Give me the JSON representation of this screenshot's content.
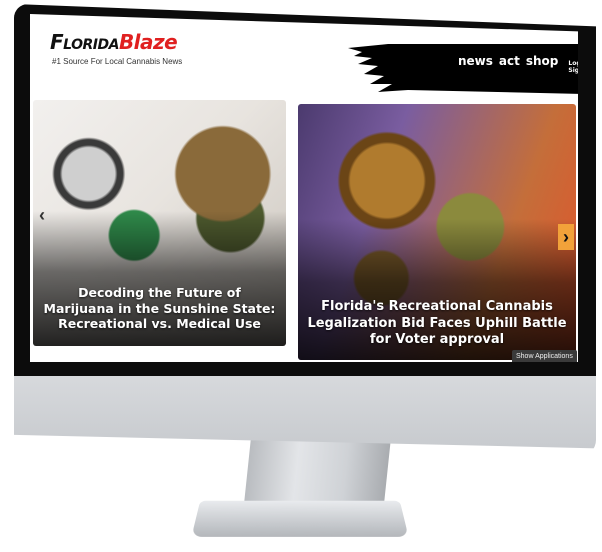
{
  "brand": {
    "logo_part1": "Florida",
    "logo_part2": "Blaze",
    "tagline": "#1 Source For Local Cannabis News"
  },
  "nav": {
    "items": [
      "news",
      "act",
      "shop"
    ],
    "auth_label": "Login | Signup"
  },
  "carousel": {
    "prev_icon": "‹",
    "next_icon": "›",
    "slides": [
      {
        "headline": "Decoding the Future of Marijuana in the Sunshine State: Recreational vs. Medical Use"
      },
      {
        "headline": "Florida's Recreational Cannabis Legalization Bid Faces Uphill Battle for Voter approval"
      }
    ]
  },
  "taskbar": {
    "show_apps_label": "Show Applications"
  },
  "colors": {
    "brand_red": "#e02020",
    "nav_bg": "#000000",
    "arrow_accent": "#f2a23a"
  },
  "icons": {
    "prev": "chevron-left-icon",
    "next": "chevron-right-icon"
  }
}
